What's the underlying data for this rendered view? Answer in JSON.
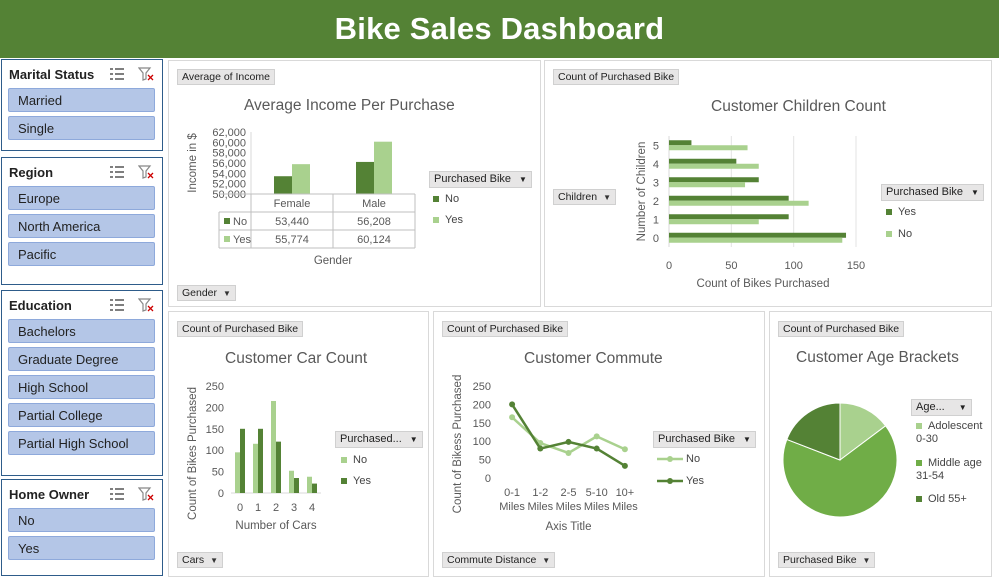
{
  "title": "Bike Sales Dashboard",
  "colors": {
    "dark_green": "#548235",
    "mid_green": "#70ad47",
    "light_green": "#a9d18e",
    "slicer_item": "#b4c6e7",
    "header": "#548235"
  },
  "slicers": [
    {
      "title": "Marital Status",
      "items": [
        "Married",
        "Single"
      ]
    },
    {
      "title": "Region",
      "items": [
        "Europe",
        "North America",
        "Pacific"
      ]
    },
    {
      "title": "Education",
      "items": [
        "Bachelors",
        "Graduate Degree",
        "High School",
        "Partial College",
        "Partial High School"
      ]
    },
    {
      "title": "Home Owner",
      "items": [
        "No",
        "Yes"
      ]
    }
  ],
  "slicer_icons": [
    "multi-select-icon",
    "clear-filter-icon"
  ],
  "panels": {
    "income": {
      "value_button": "Average of Income",
      "axis_button": "Gender",
      "legend_button": "Purchased Bike",
      "legend": [
        "No",
        "Yes"
      ]
    },
    "children": {
      "value_button": "Count of Purchased Bike",
      "axis_button": "Children",
      "legend_button": "Purchased Bike",
      "legend": [
        "Yes",
        "No"
      ]
    },
    "cars": {
      "value_button": "Count of Purchased Bike",
      "axis_button": "Cars",
      "legend_button": "Purchased...",
      "legend": [
        "No",
        "Yes"
      ]
    },
    "commute": {
      "value_button": "Count of Purchased Bike",
      "axis_button": "Commute Distance",
      "legend_button": "Purchased Bike",
      "legend": [
        "No",
        "Yes"
      ]
    },
    "age": {
      "value_button": "Count of Purchased Bike",
      "axis_button": "Purchased Bike",
      "legend_button": "Age...",
      "legend": [
        "Adolescent 0-30",
        "Middle age 31-54",
        "Old 55+"
      ]
    }
  },
  "chart_data": [
    {
      "type": "bar",
      "title": "Average Income Per Purchase",
      "xlabel": "Gender",
      "ylabel": "Income in $",
      "ylim": [
        50000,
        62000
      ],
      "yticks": [
        "62,000",
        "60,000",
        "58,000",
        "56,000",
        "54,000",
        "52,000",
        "50,000"
      ],
      "categories": [
        "Female",
        "Male"
      ],
      "series": [
        {
          "name": "No",
          "values": [
            53440,
            56208
          ],
          "labels": [
            "53,440",
            "56,208"
          ]
        },
        {
          "name": "Yes",
          "values": [
            55774,
            60124
          ],
          "labels": [
            "55,774",
            "60,124"
          ]
        }
      ]
    },
    {
      "type": "bar",
      "orientation": "horizontal",
      "title": "Customer Children Count",
      "xlabel": "Count of Bikes Purchased",
      "ylabel": "Number of Children",
      "xlim": [
        0,
        150
      ],
      "xticks": [
        "0",
        "50",
        "100",
        "150"
      ],
      "categories": [
        "0",
        "1",
        "2",
        "3",
        "4",
        "5"
      ],
      "series": [
        {
          "name": "Yes",
          "values": [
            142,
            96,
            96,
            72,
            54,
            18
          ]
        },
        {
          "name": "No",
          "values": [
            139,
            72,
            112,
            61,
            72,
            63
          ]
        }
      ]
    },
    {
      "type": "bar",
      "title": "Customer Car Count",
      "xlabel": "Number of Cars",
      "ylabel": "Count of Bikes Purchased",
      "ylim": [
        0,
        250
      ],
      "yticks": [
        "250",
        "200",
        "150",
        "100",
        "50",
        "0"
      ],
      "categories": [
        "0",
        "1",
        "2",
        "3",
        "4"
      ],
      "series": [
        {
          "name": "No",
          "values": [
            95,
            115,
            215,
            52,
            38
          ]
        },
        {
          "name": "Yes",
          "values": [
            150,
            150,
            120,
            35,
            22
          ]
        }
      ]
    },
    {
      "type": "line",
      "title": "Customer Commute",
      "xlabel": "Axis Title",
      "ylabel": "Count of Bikess Purchased",
      "ylim": [
        0,
        250
      ],
      "yticks": [
        "250",
        "200",
        "150",
        "100",
        "50",
        "0"
      ],
      "categories": [
        "0-1 Miles",
        "1-2 Miles",
        "2-5 Miles",
        "5-10 Miles",
        "10+ Miles"
      ],
      "series": [
        {
          "name": "No",
          "values": [
            165,
            95,
            68,
            113,
            78
          ]
        },
        {
          "name": "Yes",
          "values": [
            200,
            80,
            98,
            80,
            33
          ]
        }
      ]
    },
    {
      "type": "pie",
      "title": "Customer Age Brackets",
      "categories": [
        "Adolescent 0-30",
        "Middle age 31-54",
        "Old 55+"
      ],
      "values": [
        71,
        318,
        92
      ]
    }
  ]
}
